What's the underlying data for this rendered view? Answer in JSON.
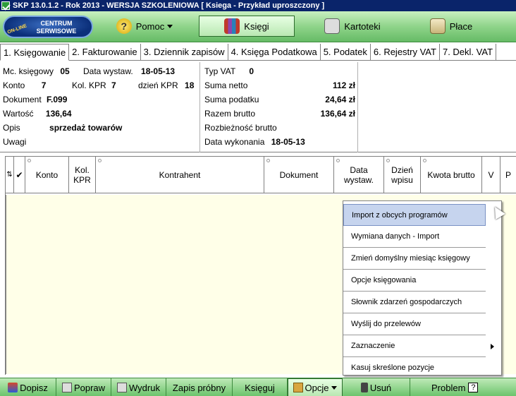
{
  "window": {
    "title": "SKP 13.0.1.2 - Rok 2013 - WERSJA SZKOLENIOWA   [ Ksiega - Przykład uproszczony ]"
  },
  "toolbar": {
    "logo_line1": "CENTRUM",
    "logo_line2": "SERWISOWE",
    "logo_badge": "ON-LINE",
    "pomoc": "Pomoc",
    "ksiegi": "Księgi",
    "kartoteki": "Kartoteki",
    "place": "Płace"
  },
  "tabs": [
    {
      "label": "1. Księgowanie"
    },
    {
      "label": "2. Fakturowanie"
    },
    {
      "label": "3. Dziennik zapisów"
    },
    {
      "label": "4. Księga Podatkowa"
    },
    {
      "label": "5. Podatek"
    },
    {
      "label": "6. Rejestry VAT"
    },
    {
      "label": "7. Dekl. VAT"
    }
  ],
  "info": {
    "mc_label": "Mc. księgowy",
    "mc_value": "05",
    "data_wystaw_label": "Data wystaw.",
    "data_wystaw_value": "18-05-13",
    "konto_label": "Konto",
    "konto_value": "7",
    "kol_kpr_label": "Kol. KPR",
    "kol_kpr_value": "7",
    "dzien_kpr_label": "dzień KPR",
    "dzien_kpr_value": "18",
    "dokument_label": "Dokument",
    "dokument_value": "F.099",
    "wartosc_label": "Wartość",
    "wartosc_value": "136,64",
    "opis_label": "Opis",
    "opis_value": "sprzedaż towarów",
    "uwagi_label": "Uwagi",
    "typ_vat_label": "Typ VAT",
    "typ_vat_value": "0",
    "suma_netto_label": "Suma netto",
    "suma_netto_value": "112 zł",
    "suma_podatku_label": "Suma podatku",
    "suma_podatku_value": "24,64 zł",
    "razem_brutto_label": "Razem brutto",
    "razem_brutto_value": "136,64 zł",
    "rozbieznosc_label": "Rozbieżność brutto",
    "data_wykonania_label": "Data wykonania",
    "data_wykonania_value": "18-05-13"
  },
  "grid": {
    "sort_icon": "sort-icon",
    "check_icon": "✔",
    "columns": {
      "konto": "Konto",
      "kol_kpr_1": "Kol.",
      "kol_kpr_2": "KPR",
      "kontrahent": "Kontrahent",
      "dokument": "Dokument",
      "data_1": "Data",
      "data_2": "wystaw.",
      "dzien_1": "Dzień",
      "dzien_2": "wpisu",
      "kwota": "Kwota brutto",
      "v": "V",
      "p": "P"
    }
  },
  "context_menu": {
    "items": [
      {
        "label": "Import z obcych programów"
      },
      {
        "label": "Wymiana danych - Import"
      },
      {
        "label": "Zmień domyślny miesiąc księgowy"
      },
      {
        "label": "Opcje księgowania"
      },
      {
        "label": "Słownik zdarzeń gospodarczych"
      },
      {
        "label": "Wyślij do przelewów"
      },
      {
        "label": "Zaznaczenie"
      },
      {
        "label": "Kasuj skreślone pozycje"
      }
    ]
  },
  "bottom": {
    "dopisz": "Dopisz",
    "popraw": "Popraw",
    "wydruk": "Wydruk",
    "zapis_probny": "Zapis próbny",
    "ksieguj": "Księguj",
    "opcje": "Opcje",
    "usun": "Usuń",
    "problem": "Problem",
    "problem_icon": "?"
  }
}
